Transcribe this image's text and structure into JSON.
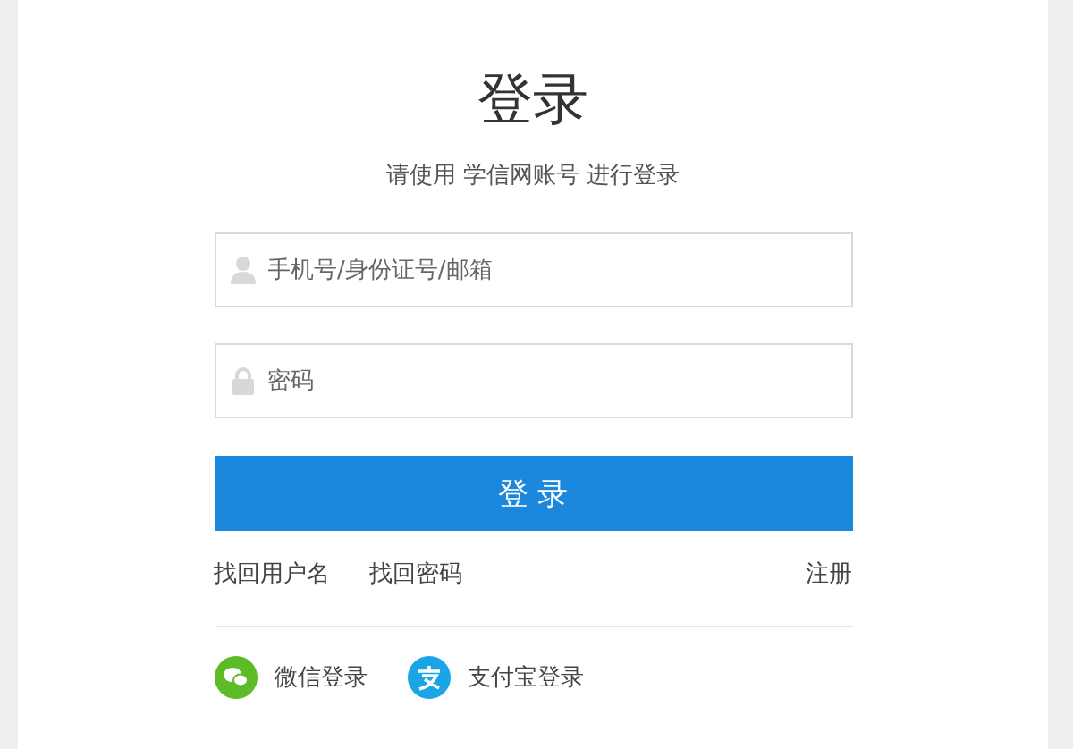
{
  "title": "登录",
  "subtitle": "请使用 学信网账号 进行登录",
  "fields": [
    {
      "kind": "user",
      "placeholder": "手机号/身份证号/邮箱"
    },
    {
      "kind": "password",
      "placeholder": "密码"
    }
  ],
  "login_button": "登 录",
  "links": {
    "left": [
      "找回用户名",
      "找回密码"
    ],
    "right": "注册"
  },
  "social_logins": [
    {
      "kind": "wechat",
      "label": "微信登录"
    },
    {
      "kind": "alipay",
      "label": "支付宝登录"
    }
  ]
}
